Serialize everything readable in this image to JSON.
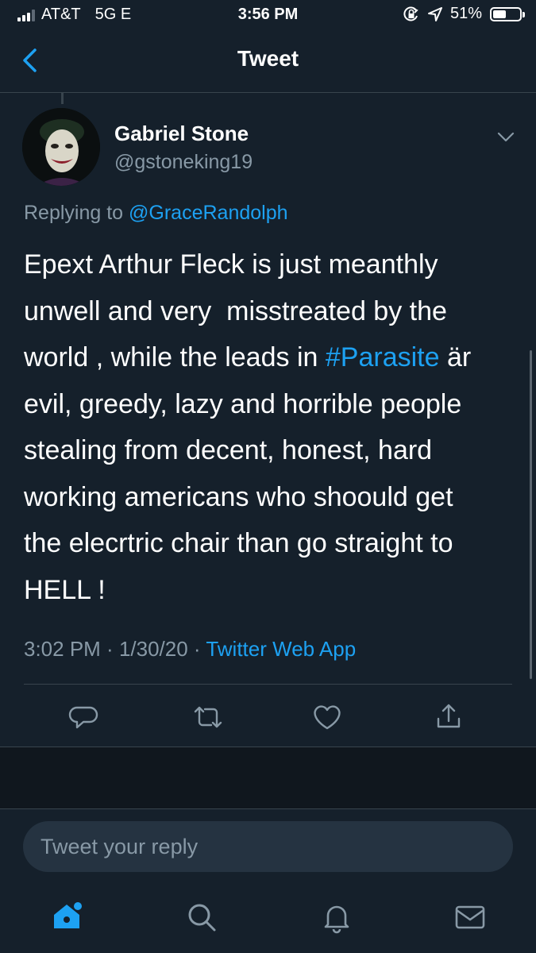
{
  "status_bar": {
    "carrier": "AT&T",
    "network": "5G E",
    "time": "3:56 PM",
    "battery": "51%",
    "battery_level": 0.51
  },
  "nav": {
    "title": "Tweet",
    "back_icon": "chevron-left-icon"
  },
  "tweet": {
    "author_name": "Gabriel Stone",
    "author_handle": "@gstoneking19",
    "replying_prefix": "Replying to ",
    "replying_to": "@GraceRandolph",
    "text_lines": [
      [
        "Epext Arthur Fleck is just meanthly"
      ],
      [
        "unwell and very  misstreated by the"
      ],
      [
        "world , while the leads in ",
        "#Parasite",
        " är"
      ],
      [
        "evil, greedy, lazy and horrible people"
      ],
      [
        "stealing from decent, honest, hard"
      ],
      [
        "working americans who shoould get"
      ],
      [
        "the elecrtric chair than go straight to"
      ],
      [
        "HELL !"
      ]
    ],
    "time": "3:02 PM",
    "separator": " · ",
    "date": "1/30/20",
    "source": "Twitter Web App"
  },
  "actions": [
    "reply-icon",
    "retweet-icon",
    "like-icon",
    "share-icon"
  ],
  "composer": {
    "placeholder": "Tweet your reply"
  },
  "tabbar": [
    "home-icon",
    "search-icon",
    "notifications-icon",
    "messages-icon"
  ],
  "colors": {
    "background": "#15202b",
    "accent": "#1da1f2",
    "secondary_text": "#8899a6",
    "divider": "#38444d"
  }
}
